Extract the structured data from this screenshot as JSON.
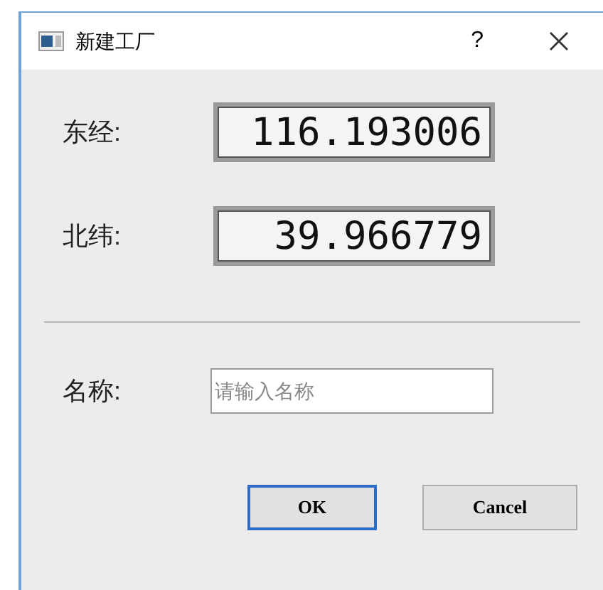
{
  "window": {
    "title": "新建工厂",
    "help": "?"
  },
  "readouts": [
    {
      "label": "东经:",
      "value": "116.193006"
    },
    {
      "label": "北纬:",
      "value": "39.966779"
    }
  ],
  "name_field": {
    "label": "名称:",
    "placeholder": "请输入名称"
  },
  "buttons": [
    {
      "label": "OK",
      "default": true
    },
    {
      "label": "Cancel",
      "default": false
    }
  ]
}
